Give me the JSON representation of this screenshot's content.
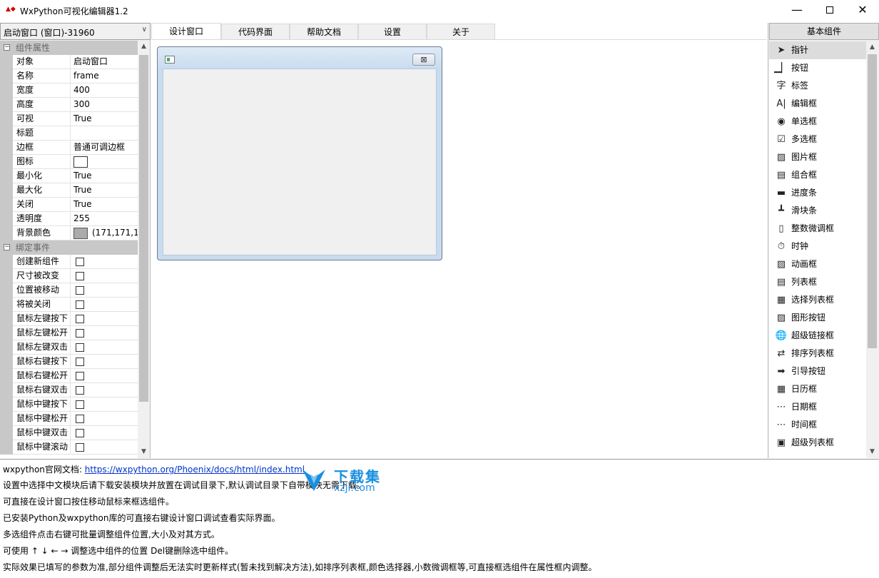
{
  "window": {
    "title": "WxPython可视化编辑器1.2",
    "icon": "wx-app-icon",
    "controls": {
      "minimize": "—",
      "close": "✕"
    }
  },
  "left_panel": {
    "selector_value": "启动窗口 (窗口)-31960",
    "property_category": "组件属性",
    "properties": [
      {
        "name": "对象",
        "value": "启动窗口"
      },
      {
        "name": "名称",
        "value": "frame"
      },
      {
        "name": "宽度",
        "value": "400"
      },
      {
        "name": "高度",
        "value": "300"
      },
      {
        "name": "可视",
        "value": "True"
      },
      {
        "name": "标题",
        "value": ""
      },
      {
        "name": "边框",
        "value": "普通可调边框"
      },
      {
        "name": "图标",
        "value": ""
      },
      {
        "name": "最小化",
        "value": "True"
      },
      {
        "name": "最大化",
        "value": "True"
      },
      {
        "name": "关闭",
        "value": "True"
      },
      {
        "name": "透明度",
        "value": "255"
      },
      {
        "name": "背景颜色",
        "value": "(171,171,1"
      }
    ],
    "background_color_swatch": "#ababab",
    "event_category": "绑定事件",
    "events": [
      {
        "name": "创建新组件",
        "checked": false
      },
      {
        "name": "尺寸被改变",
        "checked": false
      },
      {
        "name": "位置被移动",
        "checked": false
      },
      {
        "name": "将被关闭",
        "checked": false
      },
      {
        "name": "鼠标左键按下",
        "checked": false
      },
      {
        "name": "鼠标左键松开",
        "checked": false
      },
      {
        "name": "鼠标左键双击",
        "checked": false
      },
      {
        "name": "鼠标右键按下",
        "checked": false
      },
      {
        "name": "鼠标右键松开",
        "checked": false
      },
      {
        "name": "鼠标右键双击",
        "checked": false
      },
      {
        "name": "鼠标中键按下",
        "checked": false
      },
      {
        "name": "鼠标中键松开",
        "checked": false
      },
      {
        "name": "鼠标中键双击",
        "checked": false
      },
      {
        "name": "鼠标中键滚动",
        "checked": false
      }
    ]
  },
  "tabs": [
    {
      "label": "设计窗口",
      "active": true
    },
    {
      "label": "代码界面",
      "active": false
    },
    {
      "label": "帮助文档",
      "active": false
    },
    {
      "label": "设置",
      "active": false
    },
    {
      "label": "关于",
      "active": false
    }
  ],
  "design": {
    "frame_close_glyph": "⊠"
  },
  "right_panel": {
    "header": "基本组件",
    "items": [
      {
        "label": "指针",
        "icon": "pointer-icon",
        "glyph": "➤",
        "selected": true
      },
      {
        "label": "按钮",
        "icon": "button-icon",
        "glyph": "▁▏",
        "selected": false
      },
      {
        "label": "标签",
        "icon": "label-icon",
        "glyph": "字",
        "selected": false
      },
      {
        "label": "编辑框",
        "icon": "textbox-icon",
        "glyph": "A|",
        "selected": false
      },
      {
        "label": "单选框",
        "icon": "radio-icon",
        "glyph": "◉",
        "selected": false
      },
      {
        "label": "多选框",
        "icon": "checkbox-icon",
        "glyph": "☑",
        "selected": false
      },
      {
        "label": "图片框",
        "icon": "image-icon",
        "glyph": "▨",
        "selected": false
      },
      {
        "label": "组合框",
        "icon": "combobox-icon",
        "glyph": "▤",
        "selected": false
      },
      {
        "label": "进度条",
        "icon": "progressbar-icon",
        "glyph": "▬",
        "selected": false
      },
      {
        "label": "滑块条",
        "icon": "slider-icon",
        "glyph": "┻",
        "selected": false
      },
      {
        "label": "整数微调框",
        "icon": "spinner-icon",
        "glyph": "▯",
        "selected": false
      },
      {
        "label": "时钟",
        "icon": "timer-icon",
        "glyph": "⏱",
        "selected": false
      },
      {
        "label": "动画框",
        "icon": "animation-icon",
        "glyph": "▨",
        "selected": false
      },
      {
        "label": "列表框",
        "icon": "listbox-icon",
        "glyph": "▤",
        "selected": false
      },
      {
        "label": "选择列表框",
        "icon": "checklistbox-icon",
        "glyph": "▦",
        "selected": false
      },
      {
        "label": "图形按钮",
        "icon": "bitmap-button-icon",
        "glyph": "▨",
        "selected": false
      },
      {
        "label": "超级链接框",
        "icon": "hyperlink-icon",
        "glyph": "🌐",
        "selected": false
      },
      {
        "label": "排序列表框",
        "icon": "sortlist-icon",
        "glyph": "⇄",
        "selected": false
      },
      {
        "label": "引导按钮",
        "icon": "command-link-icon",
        "glyph": "➡",
        "selected": false
      },
      {
        "label": "日历框",
        "icon": "calendar-icon",
        "glyph": "▦",
        "selected": false
      },
      {
        "label": "日期框",
        "icon": "date-picker-icon",
        "glyph": "⋯",
        "selected": false
      },
      {
        "label": "时间框",
        "icon": "time-picker-icon",
        "glyph": "⋯",
        "selected": false
      },
      {
        "label": "超级列表框",
        "icon": "listctrl-icon",
        "glyph": "▣",
        "selected": false
      }
    ]
  },
  "info": {
    "doc_label": "wxpython官网文档:",
    "doc_link": "https://wxpython.org/Phoenix/docs/html/index.html",
    "lines": [
      "设置中选择中文模块后请下载安装模块并放置在调试目录下,默认调试目录下自带模块无需下载。",
      "可直接在设计窗口按住移动鼠标来框选组件。",
      "已安装Python及wxpython库的可直接右键设计窗口调试查看实际界面。",
      "多选组件点击右键可批量调整组件位置,大小及对其方式。",
      "可使用 ↑ ↓ ← → 调整选中组件的位置 Del键删除选中组件。",
      "实际效果已填写的参数为准,部分组件调整后无法实时更新样式(暂未找到解决方法),如排序列表框,颜色选择器,小数微调框等,可直接框选组件在属性框内调整。"
    ],
    "watermark_title": "下载集",
    "watermark_domain": "xzji.com"
  }
}
